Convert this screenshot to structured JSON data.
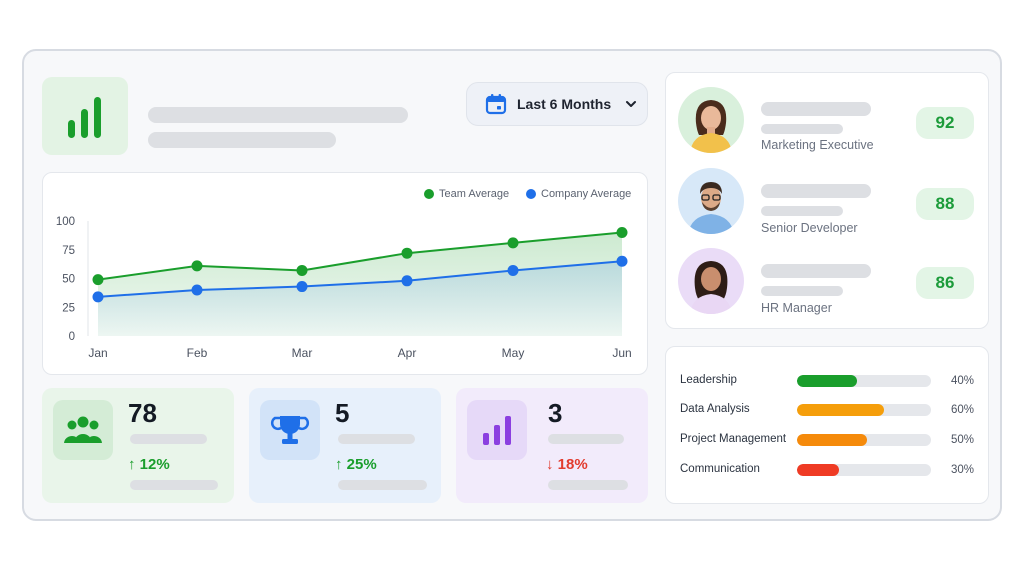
{
  "filter": {
    "label": "Last 6 Months"
  },
  "colors": {
    "team": "#1a9e2c",
    "company": "#1f6fe8",
    "up": "#1a9e2c",
    "down": "#e23b2e"
  },
  "chart_data": {
    "type": "line",
    "categories": [
      "Jan",
      "Feb",
      "Mar",
      "Apr",
      "May",
      "Jun"
    ],
    "series": [
      {
        "name": "Team Average",
        "values": [
          49,
          61,
          57,
          72,
          81,
          90
        ],
        "color": "#1a9e2c"
      },
      {
        "name": "Company Average",
        "values": [
          34,
          40,
          43,
          48,
          57,
          65
        ],
        "color": "#1f6fe8"
      }
    ],
    "yticks": [
      "100",
      "75",
      "50",
      "25",
      "0"
    ],
    "ylim": [
      0,
      100
    ],
    "grid": false,
    "legend": "top-right",
    "area_fill": true
  },
  "stats": [
    {
      "value": "78",
      "change": "12%",
      "direction": "up",
      "icon": "people-icon"
    },
    {
      "value": "5",
      "change": "25%",
      "direction": "up",
      "icon": "trophy-icon"
    },
    {
      "value": "3",
      "change": "18%",
      "direction": "down",
      "icon": "bar-chart-icon"
    }
  ],
  "people": [
    {
      "role": "Marketing Executive",
      "score": "92"
    },
    {
      "role": "Senior Developer",
      "score": "88"
    },
    {
      "role": "HR Manager",
      "score": "86"
    }
  ],
  "skills": [
    {
      "name": "Leadership",
      "percent_label": "40%",
      "value": 0.45,
      "color": "#1a9e2c"
    },
    {
      "name": "Data Analysis",
      "percent_label": "60%",
      "value": 0.65,
      "color": "#f59e0b"
    },
    {
      "name": "Project Management",
      "percent_label": "50%",
      "value": 0.52,
      "color": "#f58a0b"
    },
    {
      "name": "Communication",
      "percent_label": "30%",
      "value": 0.31,
      "color": "#ef3b24"
    }
  ]
}
